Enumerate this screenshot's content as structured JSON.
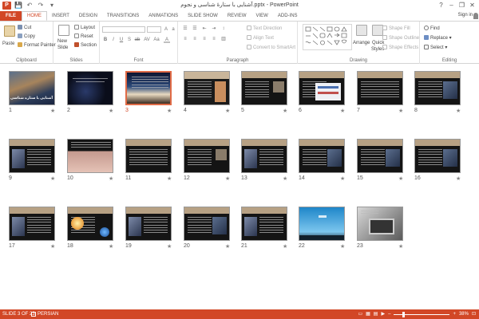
{
  "window": {
    "app_icon": "P",
    "title": "آشنایی با ستارۀ شناسی و نجوم.pptx - PowerPoint",
    "help": "?",
    "min": "–",
    "restore": "❐",
    "close": "✕"
  },
  "qat": {
    "save": "💾",
    "undo": "↶",
    "redo": "↷",
    "customize": "▾"
  },
  "tabs": [
    {
      "label": "FILE"
    },
    {
      "label": "HOME"
    },
    {
      "label": "INSERT"
    },
    {
      "label": "DESIGN"
    },
    {
      "label": "TRANSITIONS"
    },
    {
      "label": "ANIMATIONS"
    },
    {
      "label": "SLIDE SHOW"
    },
    {
      "label": "REVIEW"
    },
    {
      "label": "VIEW"
    },
    {
      "label": "ADD-INS"
    }
  ],
  "signin": "Sign in",
  "ribbon": {
    "clipboard": {
      "paste": "Paste",
      "cut": "Cut",
      "copy": "Copy",
      "format_painter": "Format Painter",
      "label": "Clipboard"
    },
    "slides": {
      "new_slide": "New",
      "new_slide2": "Slide",
      "layout": "Layout",
      "reset": "Reset",
      "section": "Section",
      "label": "Slides"
    },
    "font": {
      "label": "Font"
    },
    "paragraph": {
      "text_direction": "Text Direction",
      "align_text": "Align Text",
      "convert": "Convert to SmartArt",
      "label": "Paragraph"
    },
    "drawing": {
      "arrange": "Arrange",
      "quick_styles": "Quick",
      "quick_styles2": "Styles",
      "shape_fill": "Shape Fill",
      "shape_outline": "Shape Outline",
      "shape_effects": "Shape Effects",
      "label": "Drawing"
    },
    "editing": {
      "find": "Find",
      "replace": "Replace",
      "select": "Select",
      "label": "Editing"
    }
  },
  "slides": [
    {
      "num": "1",
      "theme": "cover",
      "caption": "آشنایی با ستاره شناسی و نجوم"
    },
    {
      "num": "2",
      "theme": "stars"
    },
    {
      "num": "3",
      "theme": "nebula",
      "selected": true
    },
    {
      "num": "4",
      "theme": "sepia-doc"
    },
    {
      "num": "5",
      "theme": "dark-text-img"
    },
    {
      "num": "6",
      "theme": "chart"
    },
    {
      "num": "7",
      "theme": "dark-text"
    },
    {
      "num": "8",
      "theme": "dark-img"
    },
    {
      "num": "9",
      "theme": "dark-img-left"
    },
    {
      "num": "10",
      "theme": "pink"
    },
    {
      "num": "11",
      "theme": "dark-text"
    },
    {
      "num": "12",
      "theme": "dark-text-img"
    },
    {
      "num": "13",
      "theme": "dark-img-left"
    },
    {
      "num": "14",
      "theme": "dark-img-right"
    },
    {
      "num": "15",
      "theme": "dark-img-right"
    },
    {
      "num": "16",
      "theme": "dark-img"
    },
    {
      "num": "17",
      "theme": "dark-img-left"
    },
    {
      "num": "18",
      "theme": "planets"
    },
    {
      "num": "19",
      "theme": "dark-img-left"
    },
    {
      "num": "20",
      "theme": "dark-img"
    },
    {
      "num": "21",
      "theme": "dark-img-left"
    },
    {
      "num": "22",
      "theme": "sky"
    },
    {
      "num": "23",
      "theme": "laptop"
    }
  ],
  "status": {
    "slide_of": "SLIDE 3 OF 23",
    "language": "PERSIAN",
    "zoom": "38%",
    "zoom_value": 38
  },
  "colors": {
    "accent": "#d24726"
  }
}
